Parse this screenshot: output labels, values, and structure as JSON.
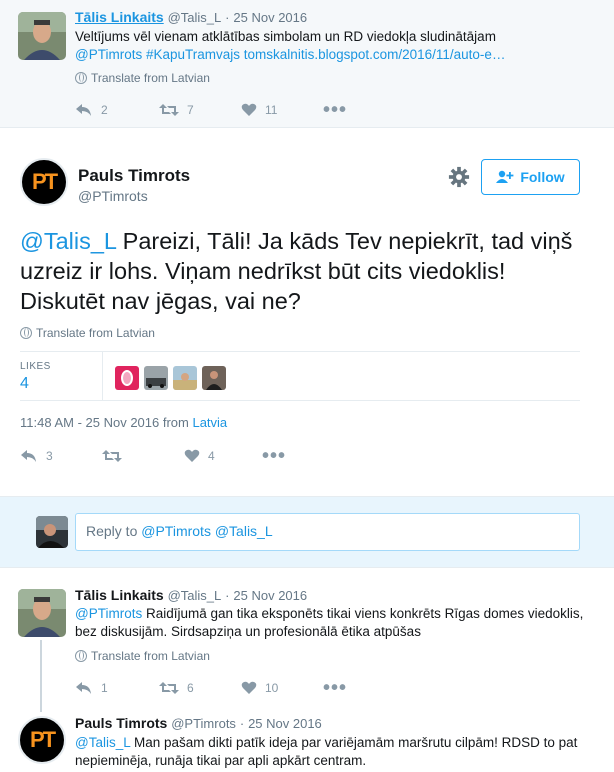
{
  "top_tweet": {
    "name": "Tālis Linkaits",
    "handle": "@Talis_L",
    "separator": "·",
    "date": "25 Nov 2016",
    "text_line1": "Veltījums vēl vienam atklātības simbolam un RD viedokļa sludinātājam",
    "text_mention": "@PTimrots",
    "text_hashtag": "#KapuTramvajs",
    "text_url": "tomskalnitis.blogspot.com/2016/11/auto-e…",
    "translate": "Translate from Latvian",
    "replies": "2",
    "retweets": "7",
    "likes": "11"
  },
  "main_tweet": {
    "avatar_initials": "PT",
    "name": "Pauls Timrots",
    "handle": "@PTimrots",
    "follow_label": "Follow",
    "mention": "@Talis_L",
    "text": " Pareizi, Tāli! Ja kāds Tev nepiekrīt, tad viņš uzreiz ir lohs. Viņam nedrīkst būt cits viedoklis! Diskutēt nav jēgas, vai ne?",
    "translate": "Translate from Latvian",
    "likes_label": "LIKES",
    "likes_count": "4",
    "timestamp": "11:48 AM - 25 Nov 2016 from ",
    "location": "Latvia",
    "replies": "3",
    "likes": "4"
  },
  "reply_box": {
    "prefix": "Reply to ",
    "mentions": "@PTimrots @Talis_L"
  },
  "reply1": {
    "name": "Tālis Linkaits",
    "handle": "@Talis_L",
    "separator": "·",
    "date": "25 Nov 2016",
    "mention": "@PTimrots",
    "text": " Raidījumā gan tika eksponēts tikai viens konkrēts Rīgas domes viedoklis, bez diskusijām. Sirdsapziņa un profesionālā ētika atpūšas",
    "translate": "Translate from Latvian",
    "replies": "1",
    "retweets": "6",
    "likes": "10"
  },
  "reply2": {
    "avatar_initials": "PT",
    "name": "Pauls Timrots",
    "handle": "@PTimrots",
    "separator": "·",
    "date": "25 Nov 2016",
    "mention": "@Talis_L",
    "text": " Man pašam dikti patīk ideja par variējamām maršrutu cilpām! RDSD to pat nepieminēja, runāja tikai par apli apkārt centram."
  },
  "colors": {
    "accent": "#1da1f2",
    "link": "#1b95e0",
    "like_heart": "#e0245e",
    "pt_orange": "#f7931e"
  }
}
